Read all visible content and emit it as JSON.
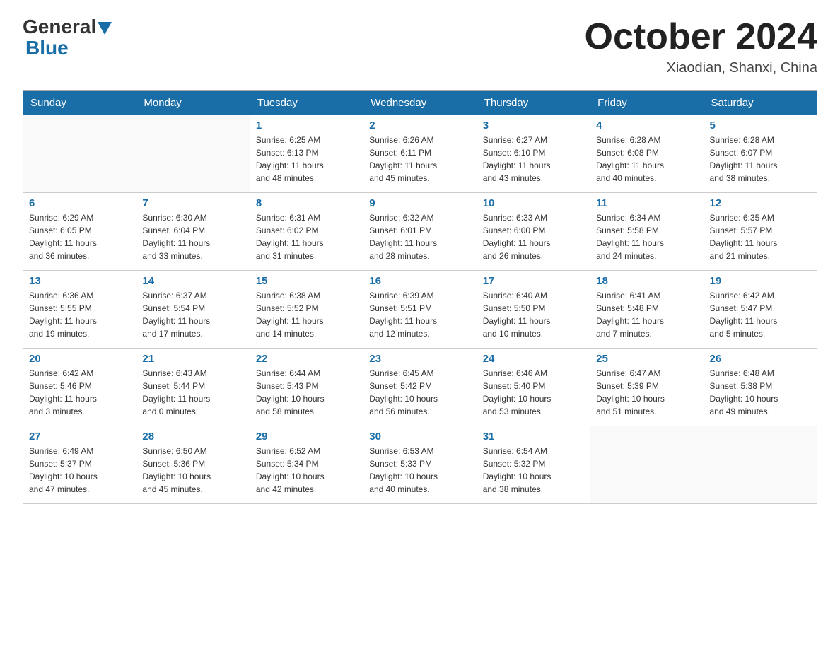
{
  "logo": {
    "general": "General",
    "blue": "Blue"
  },
  "title": "October 2024",
  "subtitle": "Xiaodian, Shanxi, China",
  "days_of_week": [
    "Sunday",
    "Monday",
    "Tuesday",
    "Wednesday",
    "Thursday",
    "Friday",
    "Saturday"
  ],
  "weeks": [
    [
      {
        "day": "",
        "info": ""
      },
      {
        "day": "",
        "info": ""
      },
      {
        "day": "1",
        "info": "Sunrise: 6:25 AM\nSunset: 6:13 PM\nDaylight: 11 hours\nand 48 minutes."
      },
      {
        "day": "2",
        "info": "Sunrise: 6:26 AM\nSunset: 6:11 PM\nDaylight: 11 hours\nand 45 minutes."
      },
      {
        "day": "3",
        "info": "Sunrise: 6:27 AM\nSunset: 6:10 PM\nDaylight: 11 hours\nand 43 minutes."
      },
      {
        "day": "4",
        "info": "Sunrise: 6:28 AM\nSunset: 6:08 PM\nDaylight: 11 hours\nand 40 minutes."
      },
      {
        "day": "5",
        "info": "Sunrise: 6:28 AM\nSunset: 6:07 PM\nDaylight: 11 hours\nand 38 minutes."
      }
    ],
    [
      {
        "day": "6",
        "info": "Sunrise: 6:29 AM\nSunset: 6:05 PM\nDaylight: 11 hours\nand 36 minutes."
      },
      {
        "day": "7",
        "info": "Sunrise: 6:30 AM\nSunset: 6:04 PM\nDaylight: 11 hours\nand 33 minutes."
      },
      {
        "day": "8",
        "info": "Sunrise: 6:31 AM\nSunset: 6:02 PM\nDaylight: 11 hours\nand 31 minutes."
      },
      {
        "day": "9",
        "info": "Sunrise: 6:32 AM\nSunset: 6:01 PM\nDaylight: 11 hours\nand 28 minutes."
      },
      {
        "day": "10",
        "info": "Sunrise: 6:33 AM\nSunset: 6:00 PM\nDaylight: 11 hours\nand 26 minutes."
      },
      {
        "day": "11",
        "info": "Sunrise: 6:34 AM\nSunset: 5:58 PM\nDaylight: 11 hours\nand 24 minutes."
      },
      {
        "day": "12",
        "info": "Sunrise: 6:35 AM\nSunset: 5:57 PM\nDaylight: 11 hours\nand 21 minutes."
      }
    ],
    [
      {
        "day": "13",
        "info": "Sunrise: 6:36 AM\nSunset: 5:55 PM\nDaylight: 11 hours\nand 19 minutes."
      },
      {
        "day": "14",
        "info": "Sunrise: 6:37 AM\nSunset: 5:54 PM\nDaylight: 11 hours\nand 17 minutes."
      },
      {
        "day": "15",
        "info": "Sunrise: 6:38 AM\nSunset: 5:52 PM\nDaylight: 11 hours\nand 14 minutes."
      },
      {
        "day": "16",
        "info": "Sunrise: 6:39 AM\nSunset: 5:51 PM\nDaylight: 11 hours\nand 12 minutes."
      },
      {
        "day": "17",
        "info": "Sunrise: 6:40 AM\nSunset: 5:50 PM\nDaylight: 11 hours\nand 10 minutes."
      },
      {
        "day": "18",
        "info": "Sunrise: 6:41 AM\nSunset: 5:48 PM\nDaylight: 11 hours\nand 7 minutes."
      },
      {
        "day": "19",
        "info": "Sunrise: 6:42 AM\nSunset: 5:47 PM\nDaylight: 11 hours\nand 5 minutes."
      }
    ],
    [
      {
        "day": "20",
        "info": "Sunrise: 6:42 AM\nSunset: 5:46 PM\nDaylight: 11 hours\nand 3 minutes."
      },
      {
        "day": "21",
        "info": "Sunrise: 6:43 AM\nSunset: 5:44 PM\nDaylight: 11 hours\nand 0 minutes."
      },
      {
        "day": "22",
        "info": "Sunrise: 6:44 AM\nSunset: 5:43 PM\nDaylight: 10 hours\nand 58 minutes."
      },
      {
        "day": "23",
        "info": "Sunrise: 6:45 AM\nSunset: 5:42 PM\nDaylight: 10 hours\nand 56 minutes."
      },
      {
        "day": "24",
        "info": "Sunrise: 6:46 AM\nSunset: 5:40 PM\nDaylight: 10 hours\nand 53 minutes."
      },
      {
        "day": "25",
        "info": "Sunrise: 6:47 AM\nSunset: 5:39 PM\nDaylight: 10 hours\nand 51 minutes."
      },
      {
        "day": "26",
        "info": "Sunrise: 6:48 AM\nSunset: 5:38 PM\nDaylight: 10 hours\nand 49 minutes."
      }
    ],
    [
      {
        "day": "27",
        "info": "Sunrise: 6:49 AM\nSunset: 5:37 PM\nDaylight: 10 hours\nand 47 minutes."
      },
      {
        "day": "28",
        "info": "Sunrise: 6:50 AM\nSunset: 5:36 PM\nDaylight: 10 hours\nand 45 minutes."
      },
      {
        "day": "29",
        "info": "Sunrise: 6:52 AM\nSunset: 5:34 PM\nDaylight: 10 hours\nand 42 minutes."
      },
      {
        "day": "30",
        "info": "Sunrise: 6:53 AM\nSunset: 5:33 PM\nDaylight: 10 hours\nand 40 minutes."
      },
      {
        "day": "31",
        "info": "Sunrise: 6:54 AM\nSunset: 5:32 PM\nDaylight: 10 hours\nand 38 minutes."
      },
      {
        "day": "",
        "info": ""
      },
      {
        "day": "",
        "info": ""
      }
    ]
  ]
}
